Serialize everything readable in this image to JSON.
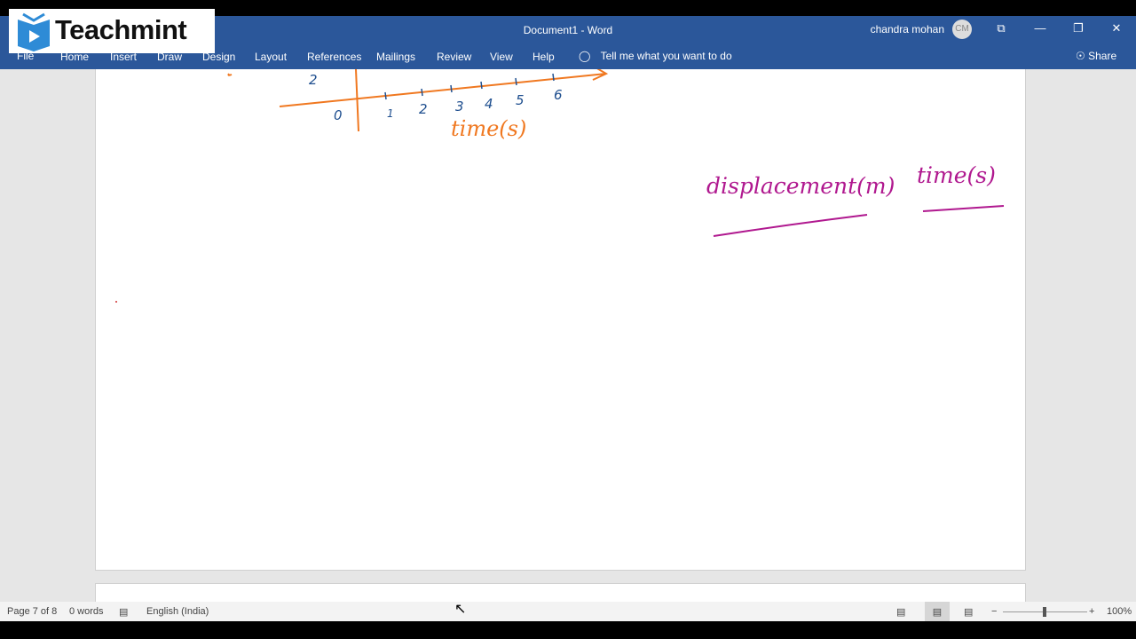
{
  "window": {
    "title": "Document1 - Word",
    "user_name": "chandra mohan",
    "user_initials": "CM",
    "controls": {
      "ribbon_display": "⧉",
      "minimize": "—",
      "restore": "❐",
      "close": "✕"
    }
  },
  "watermark": {
    "brand": "Teachmint"
  },
  "ribbon": {
    "tabs": [
      "File",
      "Home",
      "Insert",
      "Draw",
      "Design",
      "Layout",
      "References",
      "Mailings",
      "Review",
      "View",
      "Help"
    ],
    "tell_me": "Tell me what you want to do",
    "share": "Share"
  },
  "document": {
    "ink": {
      "axis_ticks_x": [
        "0",
        "1",
        "2",
        "3",
        "4",
        "5",
        "6"
      ],
      "axis_tick_y": "2",
      "x_axis_label": "time(s)",
      "column_headers": [
        "displacement(m)",
        "time(s)"
      ],
      "colors": {
        "axis": "#f07820",
        "ticks": "#1f4f8f",
        "headers": "#b0188f"
      }
    }
  },
  "statusbar": {
    "page": "Page 7 of 8",
    "words": "0 words",
    "language": "English (India)",
    "zoom": "100%",
    "zoom_minus": "−",
    "zoom_plus": "+"
  }
}
